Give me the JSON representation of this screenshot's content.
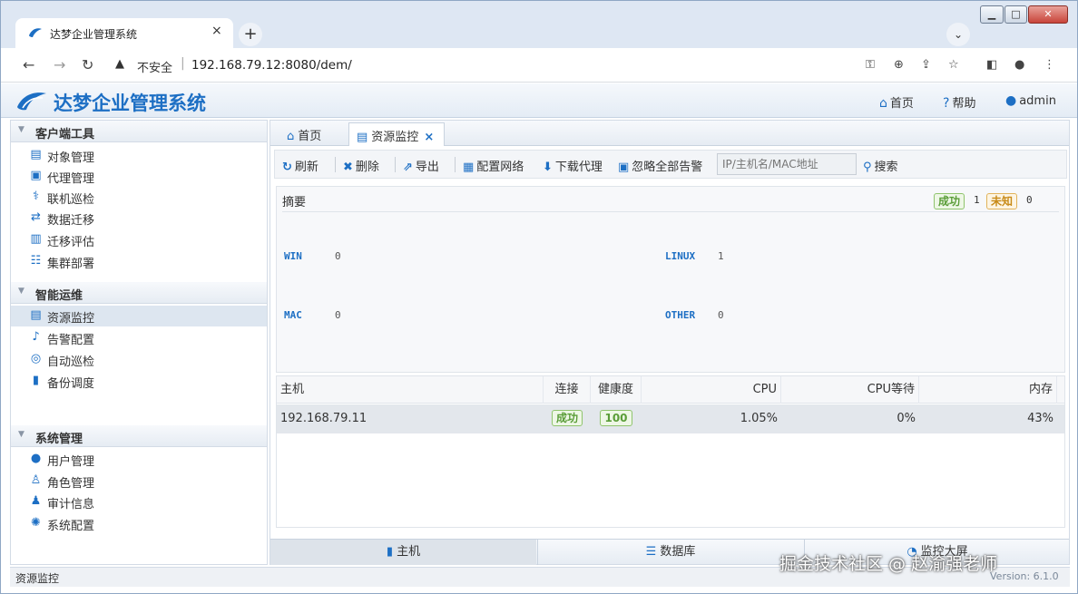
{
  "browser": {
    "tab_title": "达梦企业管理系统",
    "tab_close": "×",
    "new_tab": "+",
    "tab_search": "⌄",
    "not_secure": "不安全",
    "url": "192.168.79.12:8080/dem/"
  },
  "app": {
    "title": "达梦企业管理系统",
    "header_links": {
      "home": "首页",
      "help": "帮助",
      "user": "admin"
    }
  },
  "sidebar": {
    "groups": [
      {
        "title": "客户端工具",
        "items": [
          "对象管理",
          "代理管理",
          "联机巡检",
          "数据迁移",
          "迁移评估",
          "集群部署"
        ]
      },
      {
        "title": "智能运维",
        "items": [
          "资源监控",
          "告警配置",
          "自动巡检",
          "备份调度"
        ]
      },
      {
        "title": "系统管理",
        "items": [
          "用户管理",
          "角色管理",
          "审计信息",
          "系统配置"
        ]
      }
    ],
    "selected": "资源监控"
  },
  "main": {
    "tabs": [
      {
        "label": "首页"
      },
      {
        "label": "资源监控"
      }
    ],
    "toolbar": {
      "refresh": "刷新",
      "delete": "删除",
      "export": "导出",
      "network": "配置网络",
      "download_agent": "下载代理",
      "ignore_alerts": "忽略全部告警",
      "search_placeholder": "IP/主机名/MAC地址",
      "search": "搜索"
    },
    "summary": {
      "title": "摘要",
      "success_label": "成功",
      "success_count": "1",
      "unknown_label": "未知",
      "unknown_count": "0",
      "os": [
        {
          "name": "WIN",
          "count": "0"
        },
        {
          "name": "LINUX",
          "count": "1"
        },
        {
          "name": "MAC",
          "count": "0"
        },
        {
          "name": "OTHER",
          "count": "0"
        }
      ]
    },
    "grid": {
      "columns": [
        "主机",
        "连接",
        "健康度",
        "CPU",
        "CPU等待",
        "内存"
      ],
      "rows": [
        {
          "host": "192.168.79.11",
          "connection": "成功",
          "health": "100",
          "cpu": "1.05%",
          "cpu_wait": "0%",
          "memory": "43%"
        }
      ]
    },
    "bottom_tabs": [
      "主机",
      "数据库",
      "监控大屏"
    ]
  },
  "status": {
    "text": "资源监控",
    "version": "Version: 6.1.0"
  },
  "watermark_credit": "掘金技术社区 @ 赵渝强老师",
  "colors": {
    "accent": "#1d6fc4",
    "success": "#5a9d38",
    "warning": "#c88a17"
  }
}
